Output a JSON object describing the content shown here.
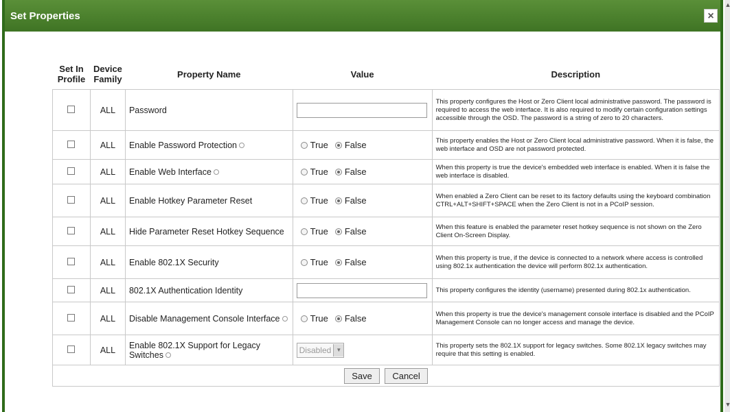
{
  "dialog": {
    "title": "Set Properties",
    "close_glyph": "×"
  },
  "table": {
    "headers": {
      "set_in_profile_1": "Set In",
      "set_in_profile_2": "Profile",
      "device_family_1": "Device",
      "device_family_2": "Family",
      "property_name": "Property Name",
      "value": "Value",
      "description": "Description"
    },
    "rows": [
      {
        "family": "ALL",
        "name": "Password",
        "type": "text",
        "value": "",
        "info": false,
        "desc": "This property configures the Host or Zero Client local administrative password. The password is required to access the web interface. It is also required to modify certain configuration settings accessible through the OSD. The password is a string of zero to 20 characters."
      },
      {
        "family": "ALL",
        "name": "Enable Password Protection",
        "type": "radio",
        "selected": "False",
        "info": true,
        "desc": "This property enables the Host or Zero Client local administrative password. When it is false, the web interface and OSD are not password protected."
      },
      {
        "family": "ALL",
        "name": "Enable Web Interface",
        "type": "radio",
        "selected": "False",
        "info": true,
        "desc": "When this property is true the device's embedded web interface is enabled. When it is false the web interface is disabled."
      },
      {
        "family": "ALL",
        "name": "Enable Hotkey Parameter Reset",
        "type": "radio",
        "selected": "False",
        "info": false,
        "desc": "When enabled a Zero Client can be reset to its factory defaults using the keyboard combination CTRL+ALT+SHIFT+SPACE when the Zero Client is not in a PCoIP session."
      },
      {
        "family": "ALL",
        "name": "Hide Parameter Reset Hotkey Sequence",
        "type": "radio",
        "selected": "False",
        "info": false,
        "desc": "When this feature is enabled the parameter reset hotkey sequence is not shown on the Zero Client On-Screen Display."
      },
      {
        "family": "ALL",
        "name": "Enable 802.1X Security",
        "type": "radio",
        "selected": "False",
        "info": false,
        "desc": "When this property is true, if the device is connected to a network where access is controlled using 802.1x authentication the device will perform 802.1x authentication."
      },
      {
        "family": "ALL",
        "name": "802.1X Authentication Identity",
        "type": "text",
        "value": "",
        "info": false,
        "desc": "This property configures the identity (username) presented during 802.1x authentication."
      },
      {
        "family": "ALL",
        "name": "Disable Management Console Interface",
        "type": "radio",
        "selected": "False",
        "info": true,
        "desc": "When this property is true the device's management console interface is disabled and the PCoIP Management Console can no longer access and manage the device."
      },
      {
        "family": "ALL",
        "name": "Enable 802.1X Support for Legacy Switches",
        "type": "select",
        "value": "Disabled",
        "info": true,
        "desc": "This property sets the 802.1X support for legacy switches. Some 802.1X legacy switches may require that this setting is enabled."
      }
    ],
    "radio_true_label": "True",
    "radio_false_label": "False"
  },
  "footer": {
    "save_label": "Save",
    "cancel_label": "Cancel"
  }
}
